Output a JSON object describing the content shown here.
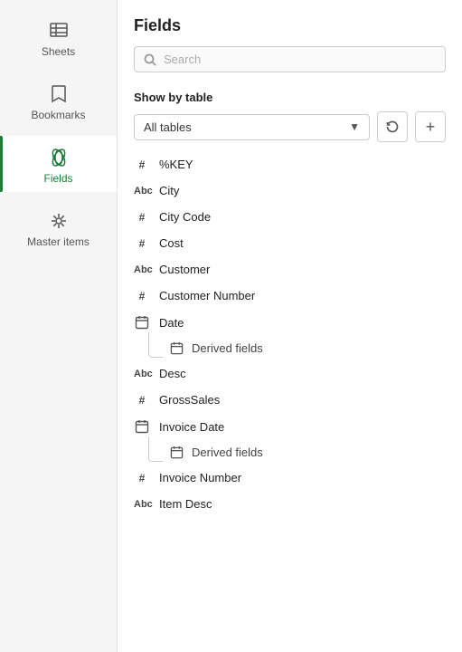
{
  "sidebar": {
    "items": [
      {
        "id": "sheets",
        "label": "Sheets",
        "icon": "sheets"
      },
      {
        "id": "bookmarks",
        "label": "Bookmarks",
        "icon": "bookmarks"
      },
      {
        "id": "fields",
        "label": "Fields",
        "icon": "fields",
        "active": true
      },
      {
        "id": "master-items",
        "label": "Master items",
        "icon": "master-items"
      }
    ]
  },
  "panel": {
    "title": "Fields",
    "search_placeholder": "Search",
    "show_by_label": "Show by table",
    "table_filter": "All tables",
    "icon_reset": "↺",
    "icon_add": "+"
  },
  "fields": [
    {
      "id": "pct-key",
      "name": "%KEY",
      "type": "hash"
    },
    {
      "id": "city",
      "name": "City",
      "type": "abc"
    },
    {
      "id": "city-code",
      "name": "City Code",
      "type": "hash"
    },
    {
      "id": "cost",
      "name": "Cost",
      "type": "hash"
    },
    {
      "id": "customer",
      "name": "Customer",
      "type": "abc"
    },
    {
      "id": "customer-number",
      "name": "Customer Number",
      "type": "hash"
    },
    {
      "id": "date",
      "name": "Date",
      "type": "date",
      "derived": {
        "name": "Derived fields",
        "type": "date"
      }
    },
    {
      "id": "desc",
      "name": "Desc",
      "type": "abc"
    },
    {
      "id": "gross-sales",
      "name": "GrossSales",
      "type": "hash"
    },
    {
      "id": "invoice-date",
      "name": "Invoice Date",
      "type": "date",
      "derived": {
        "name": "Derived fields",
        "type": "date"
      }
    },
    {
      "id": "invoice-number",
      "name": "Invoice Number",
      "type": "hash"
    },
    {
      "id": "item-desc",
      "name": "Item Desc",
      "type": "abc"
    }
  ]
}
